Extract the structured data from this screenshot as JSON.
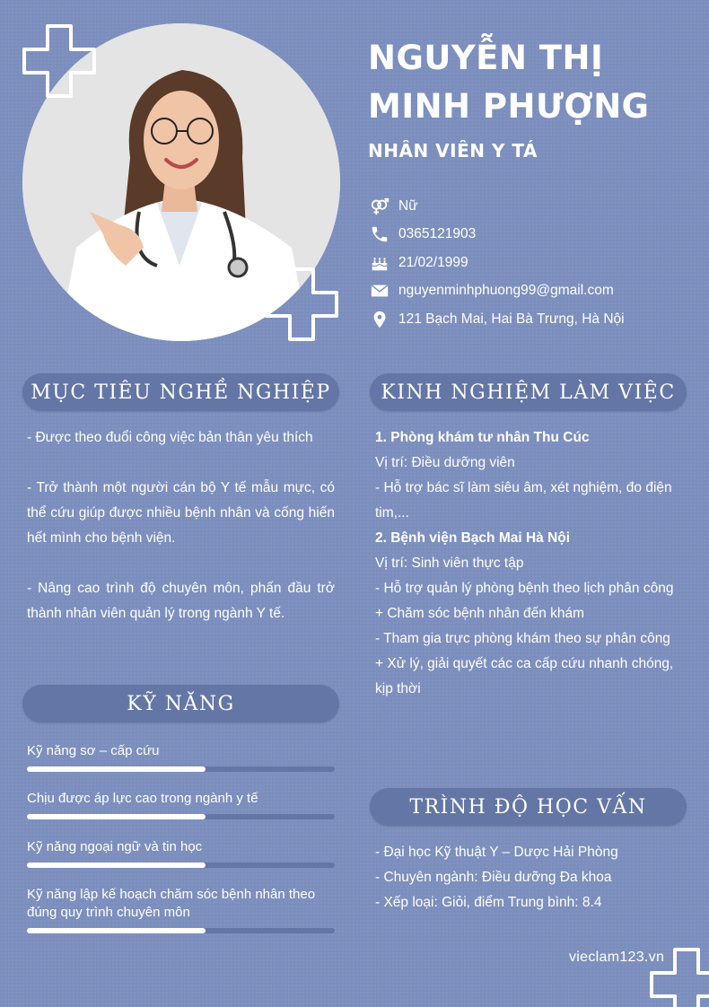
{
  "profile": {
    "name_line1": "NGUYỄN THỊ",
    "name_line2": "MINH PHƯỢNG",
    "job_title": "NHÂN VIÊN Y TÁ"
  },
  "contact": [
    {
      "icon": "gender-icon",
      "text": "Nữ"
    },
    {
      "icon": "phone-icon",
      "text": "0365121903"
    },
    {
      "icon": "birthday-cake-icon",
      "text": "21/02/1999"
    },
    {
      "icon": "email-icon",
      "text": "nguyenminhphuong99@gmail.com"
    },
    {
      "icon": "location-pin-icon",
      "text": "121 Bạch Mai, Hai Bà Trưng, Hà Nội"
    }
  ],
  "objective": {
    "title": "MỤC TIÊU NGHỀ NGHIỆP",
    "items": [
      "- Được theo đuổi công việc bản thân yêu thích",
      "- Trở thành một người cán bộ Y tế mẫu mực, có thể cứu giúp được nhiều bệnh nhân và cống hiến hết mình cho bệnh viện.",
      "- Nâng cao trình độ chuyên môn, phấn đầu trở thành nhân viên quản lý trong ngành Y tế."
    ]
  },
  "skills": {
    "title": "KỸ NĂNG",
    "items": [
      {
        "label": "Kỹ năng sơ – cấp cứu",
        "level": 0.58
      },
      {
        "label": "Chịu được áp lực cao trong ngành y tế",
        "level": 0.58
      },
      {
        "label": "Kỹ năng ngoại ngữ và tin học",
        "level": 0.58
      },
      {
        "label": "Kỹ năng lập kế hoạch chăm sóc bệnh nhân theo đúng quy trình chuyên môn",
        "level": 0.58
      }
    ]
  },
  "experience": {
    "title": "KINH NGHIỆM LÀM VIỆC",
    "job1": {
      "heading": "1. Phòng khám tư nhân Thu Cúc",
      "position": "Vị trí: Điều dưỡng viên",
      "tasks": [
        "- Hỗ trợ bác sĩ làm siêu âm, xét nghiệm, đo điện tim,..."
      ]
    },
    "job2": {
      "heading": "2. Bệnh viện Bạch Mai Hà Nội",
      "position": "Vị trí: Sinh viên thực tập",
      "tasks": [
        "- Hỗ trợ quản lý phòng bệnh theo lịch phân công",
        "+ Chăm sóc bệnh nhân đến khám",
        "- Tham gia trực phòng khám theo sự phân công",
        "+ Xử lý, giải quyết các ca cấp cứu nhanh chóng, kịp thời"
      ]
    }
  },
  "education": {
    "title": "TRÌNH ĐỘ HỌC VẤN",
    "items": [
      "- Đại học Kỹ thuật Y – Dược Hải Phòng",
      "- Chuyên ngành: Điều dưỡng Đa khoa",
      "- Xếp loại: Giỏi, điểm Trung bình: 8.4"
    ]
  },
  "footer": {
    "brand": "vieclam123.vn"
  }
}
